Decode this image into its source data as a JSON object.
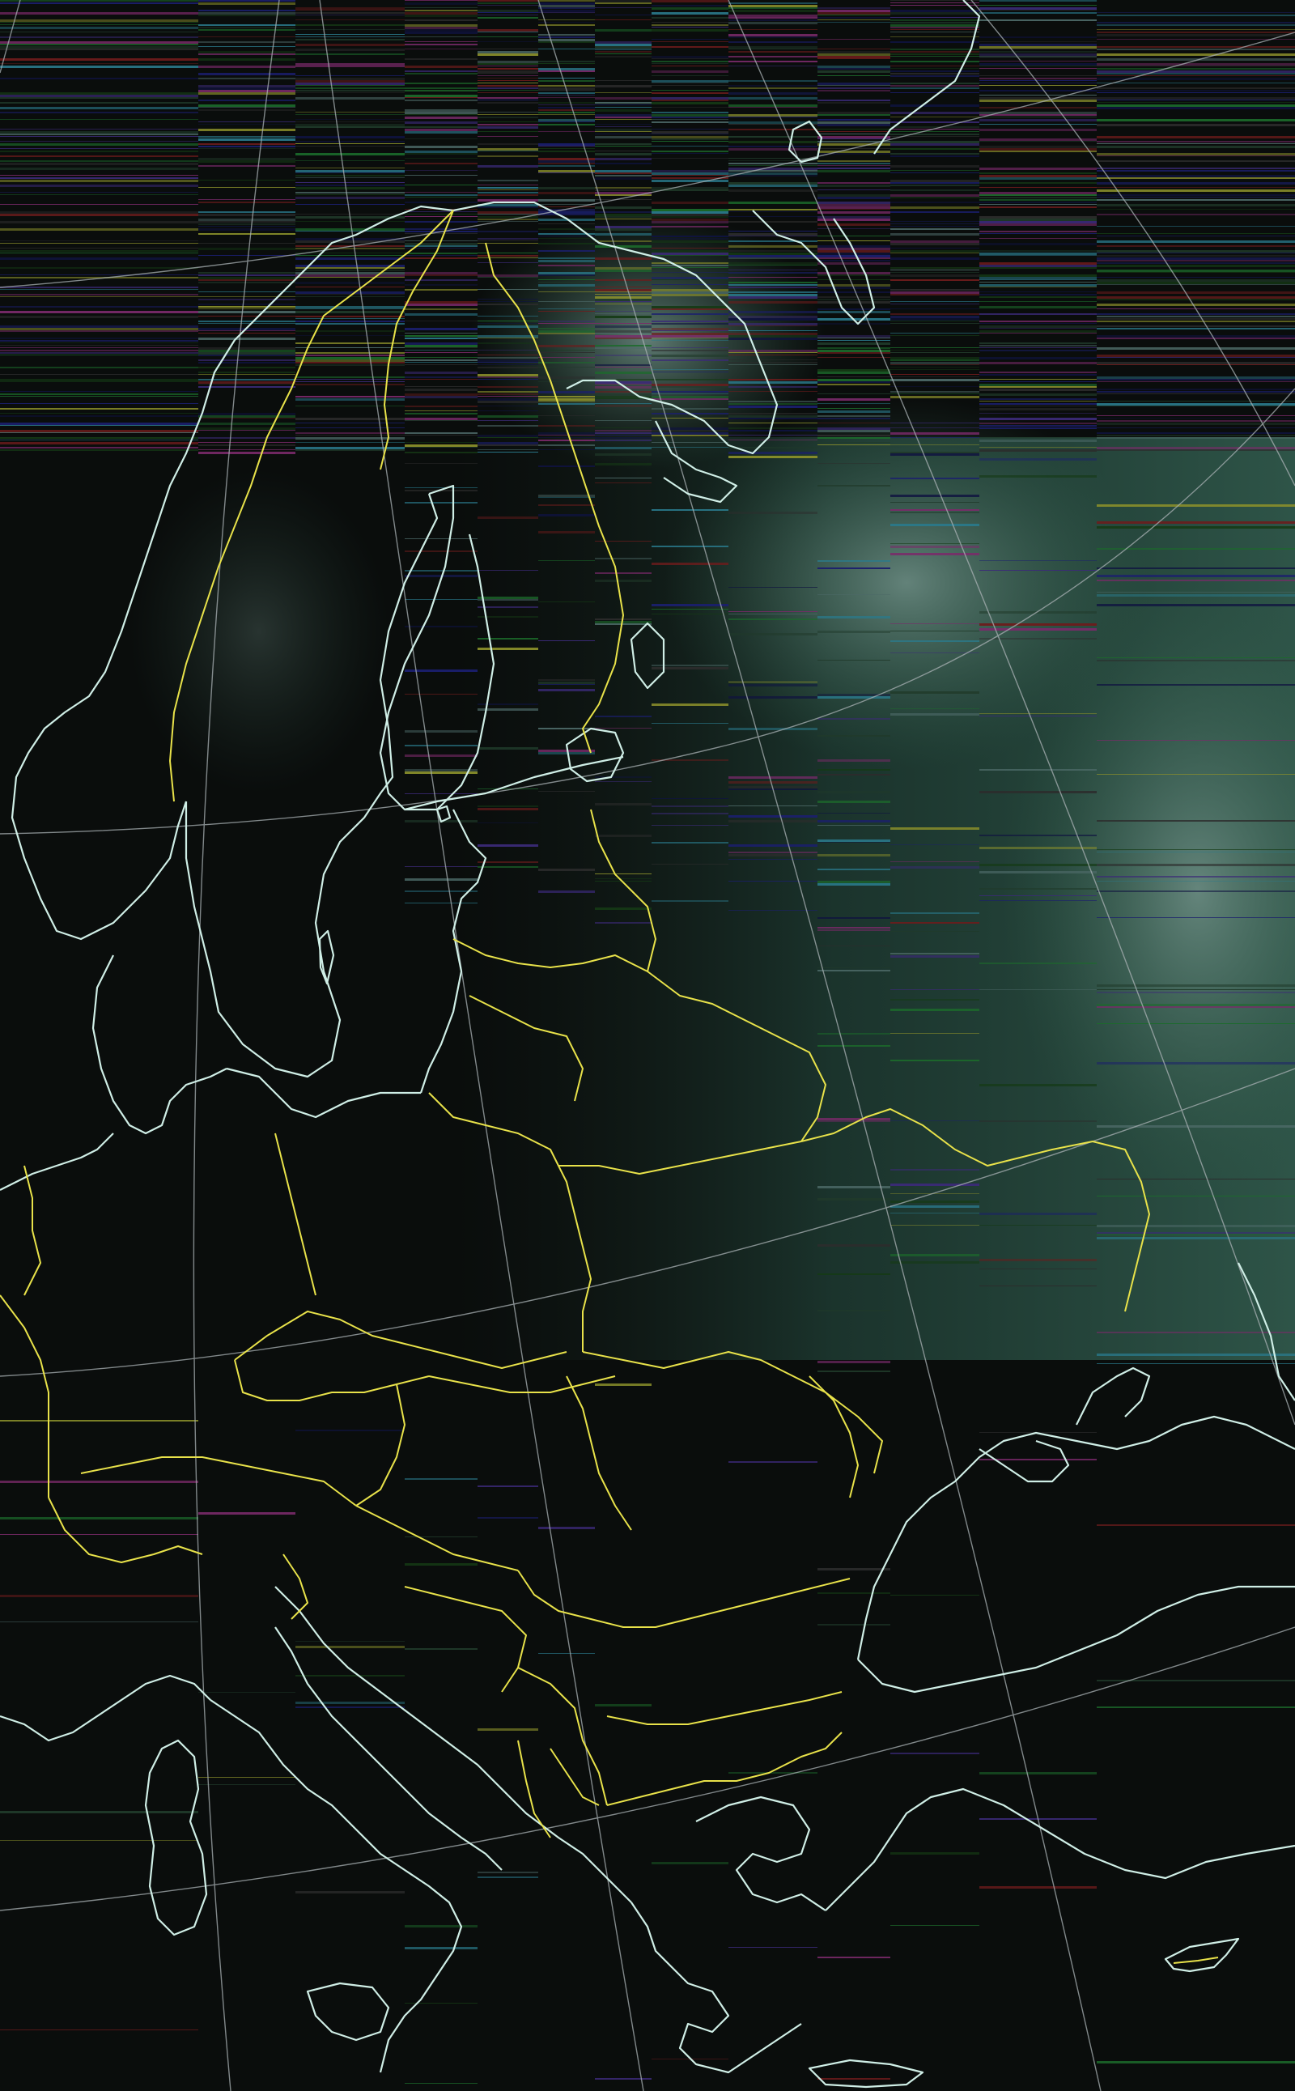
{
  "map": {
    "kind": "satellite-weather-image",
    "projection_overlay": "graticule",
    "region": "Europe",
    "colors": {
      "background": "#0a0d0c",
      "coastline": "#cfeee6",
      "border": "#e8e24a",
      "graticule": "#a9b1b4",
      "cloud_low": "#2f5a48",
      "cloud_high": "#6f8f86"
    },
    "features": {
      "coastlines": "coastline-outline",
      "borders": "country-border",
      "gridlines": "lat-lon-graticule"
    }
  }
}
